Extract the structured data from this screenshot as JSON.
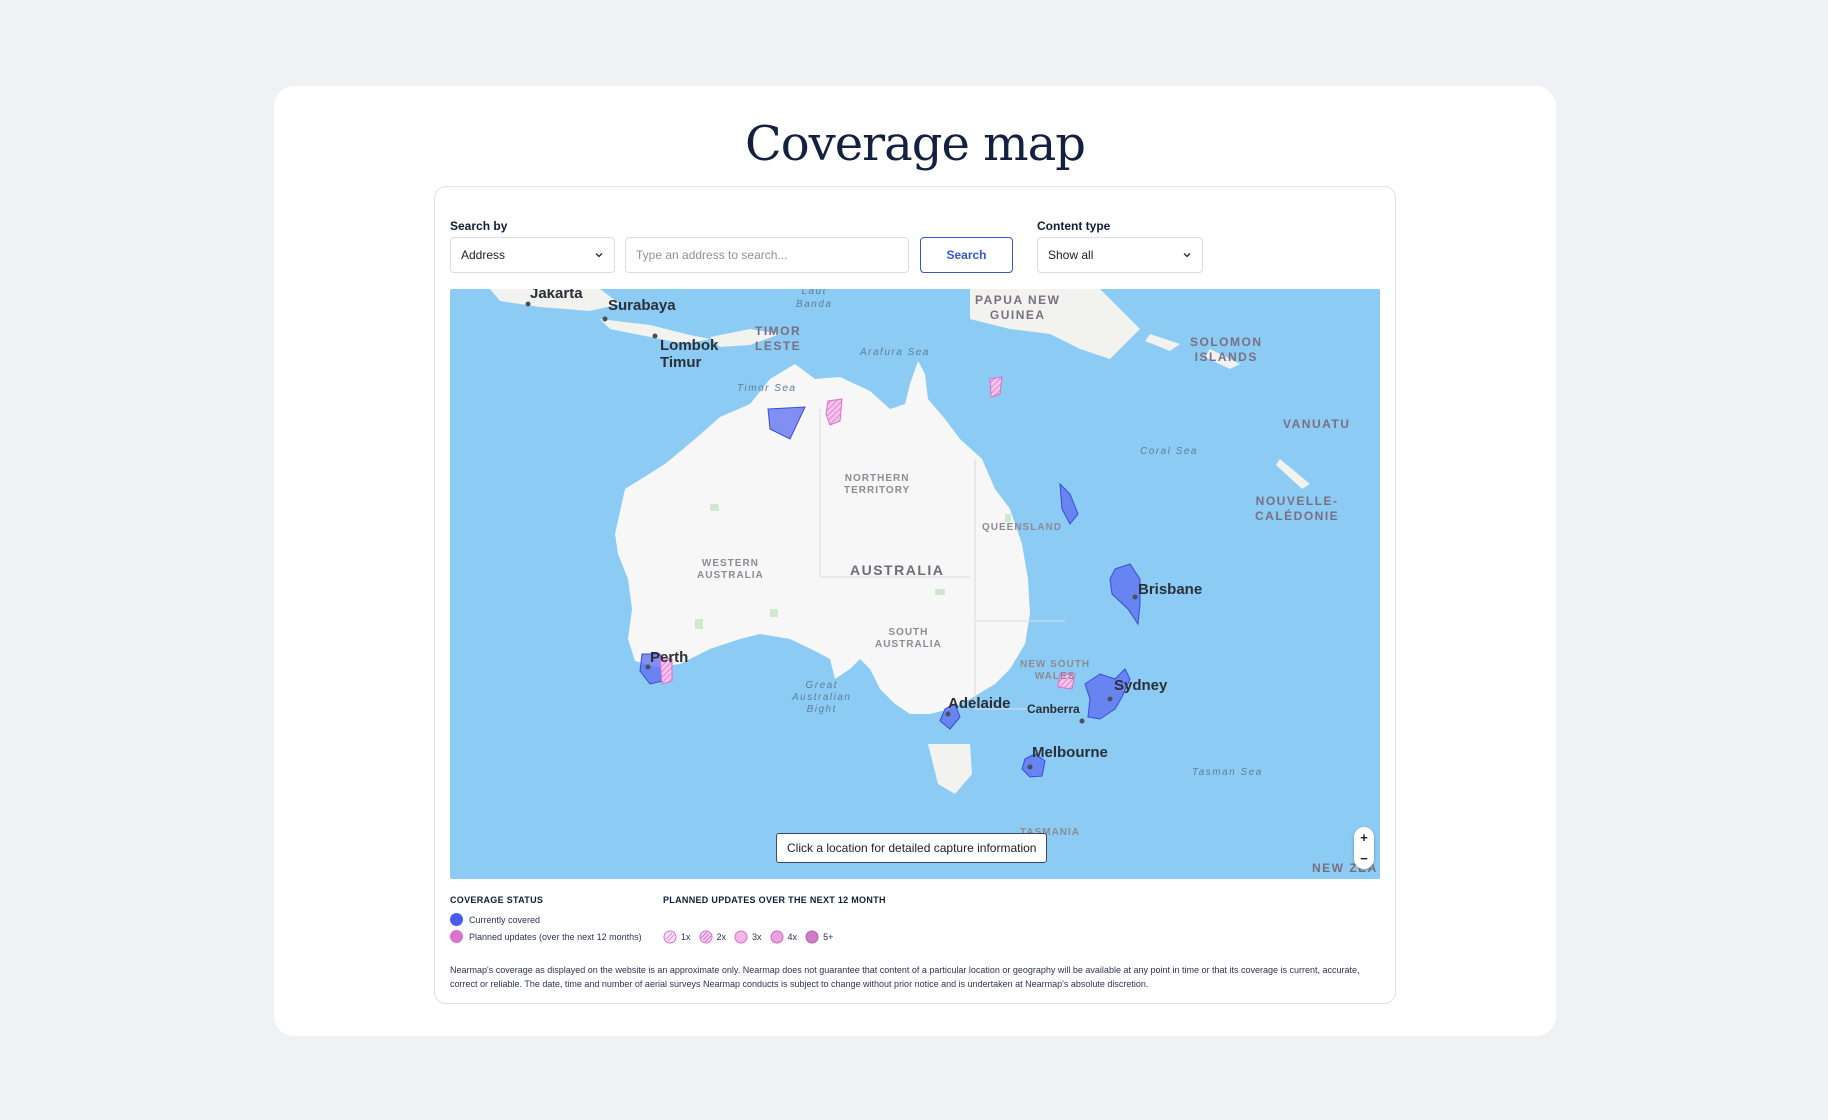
{
  "page": {
    "title": "Coverage map"
  },
  "search": {
    "search_by_label": "Search by",
    "search_by_value": "Address",
    "input_placeholder": "Type an address to search...",
    "search_button": "Search",
    "content_type_label": "Content type",
    "content_type_value": "Show all"
  },
  "map": {
    "tooltip": "Click a location for detailed capture information",
    "zoom_in": "+",
    "zoom_out": "−",
    "cities": [
      "Jakarta",
      "Surabaya",
      "Lombok",
      "Timur",
      "Brisbane",
      "Perth",
      "Sydney",
      "Adelaide",
      "Canberra",
      "Melbourne"
    ],
    "regions": [
      "NORTHERN",
      "TERRITORY",
      "QUEENSLAND",
      "WESTERN",
      "AUSTRALIA",
      "AUSTRALIA",
      "SOUTH",
      "AUSTRALIA",
      "NEW SOUTH",
      "WALES",
      "TASMANIA"
    ],
    "countries": [
      "PAPUA NEW",
      "GUINEA",
      "TIMOR",
      "LESTE",
      "SOLOMON",
      "ISLANDS",
      "VANUATU",
      "NOUVELLE-",
      "CALÉDONIE",
      "NEW ZEA"
    ],
    "seas": [
      "Laut",
      "Banda",
      "Arafura Sea",
      "Timor Sea",
      "Coral Sea",
      "Great",
      "Australian",
      "Bight",
      "Tasman Sea"
    ],
    "colors": {
      "ocean": "#8ccbf3",
      "land": "#f7f7f7",
      "covered": "#5b6cf0",
      "planned": "#e68fd7"
    }
  },
  "legend": {
    "status_heading": "COVERAGE STATUS",
    "covered_label": "Currently covered",
    "planned_label": "Planned updates (over the next 12 months)",
    "planned_heading": "PLANNED UPDATES OVER THE NEXT 12 MONTH",
    "frequencies": [
      "1x",
      "2x",
      "3x",
      "4x",
      "5+"
    ]
  },
  "disclaimer": "Nearmap's coverage as displayed on the website is an approximate only. Nearmap does not guarantee that content of a particular location or geography will be available at any point in time or that its coverage is current, accurate, correct or reliable. The date, time and number of aerial surveys Nearmap conducts is subject to change without prior notice and is undertaken at Nearmap's absolute discretion."
}
